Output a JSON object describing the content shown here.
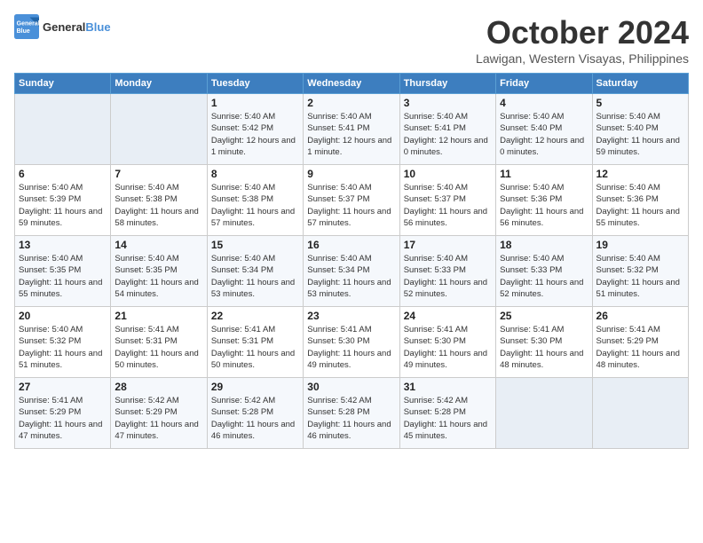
{
  "header": {
    "logo_line1": "General",
    "logo_line2": "Blue",
    "month": "October 2024",
    "location": "Lawigan, Western Visayas, Philippines"
  },
  "days_of_week": [
    "Sunday",
    "Monday",
    "Tuesday",
    "Wednesday",
    "Thursday",
    "Friday",
    "Saturday"
  ],
  "weeks": [
    [
      {
        "num": "",
        "info": "",
        "empty": true
      },
      {
        "num": "",
        "info": "",
        "empty": true
      },
      {
        "num": "1",
        "info": "Sunrise: 5:40 AM\nSunset: 5:42 PM\nDaylight: 12 hours and 1 minute.",
        "empty": false
      },
      {
        "num": "2",
        "info": "Sunrise: 5:40 AM\nSunset: 5:41 PM\nDaylight: 12 hours and 1 minute.",
        "empty": false
      },
      {
        "num": "3",
        "info": "Sunrise: 5:40 AM\nSunset: 5:41 PM\nDaylight: 12 hours and 0 minutes.",
        "empty": false
      },
      {
        "num": "4",
        "info": "Sunrise: 5:40 AM\nSunset: 5:40 PM\nDaylight: 12 hours and 0 minutes.",
        "empty": false
      },
      {
        "num": "5",
        "info": "Sunrise: 5:40 AM\nSunset: 5:40 PM\nDaylight: 11 hours and 59 minutes.",
        "empty": false
      }
    ],
    [
      {
        "num": "6",
        "info": "Sunrise: 5:40 AM\nSunset: 5:39 PM\nDaylight: 11 hours and 59 minutes.",
        "empty": false
      },
      {
        "num": "7",
        "info": "Sunrise: 5:40 AM\nSunset: 5:38 PM\nDaylight: 11 hours and 58 minutes.",
        "empty": false
      },
      {
        "num": "8",
        "info": "Sunrise: 5:40 AM\nSunset: 5:38 PM\nDaylight: 11 hours and 57 minutes.",
        "empty": false
      },
      {
        "num": "9",
        "info": "Sunrise: 5:40 AM\nSunset: 5:37 PM\nDaylight: 11 hours and 57 minutes.",
        "empty": false
      },
      {
        "num": "10",
        "info": "Sunrise: 5:40 AM\nSunset: 5:37 PM\nDaylight: 11 hours and 56 minutes.",
        "empty": false
      },
      {
        "num": "11",
        "info": "Sunrise: 5:40 AM\nSunset: 5:36 PM\nDaylight: 11 hours and 56 minutes.",
        "empty": false
      },
      {
        "num": "12",
        "info": "Sunrise: 5:40 AM\nSunset: 5:36 PM\nDaylight: 11 hours and 55 minutes.",
        "empty": false
      }
    ],
    [
      {
        "num": "13",
        "info": "Sunrise: 5:40 AM\nSunset: 5:35 PM\nDaylight: 11 hours and 55 minutes.",
        "empty": false
      },
      {
        "num": "14",
        "info": "Sunrise: 5:40 AM\nSunset: 5:35 PM\nDaylight: 11 hours and 54 minutes.",
        "empty": false
      },
      {
        "num": "15",
        "info": "Sunrise: 5:40 AM\nSunset: 5:34 PM\nDaylight: 11 hours and 53 minutes.",
        "empty": false
      },
      {
        "num": "16",
        "info": "Sunrise: 5:40 AM\nSunset: 5:34 PM\nDaylight: 11 hours and 53 minutes.",
        "empty": false
      },
      {
        "num": "17",
        "info": "Sunrise: 5:40 AM\nSunset: 5:33 PM\nDaylight: 11 hours and 52 minutes.",
        "empty": false
      },
      {
        "num": "18",
        "info": "Sunrise: 5:40 AM\nSunset: 5:33 PM\nDaylight: 11 hours and 52 minutes.",
        "empty": false
      },
      {
        "num": "19",
        "info": "Sunrise: 5:40 AM\nSunset: 5:32 PM\nDaylight: 11 hours and 51 minutes.",
        "empty": false
      }
    ],
    [
      {
        "num": "20",
        "info": "Sunrise: 5:40 AM\nSunset: 5:32 PM\nDaylight: 11 hours and 51 minutes.",
        "empty": false
      },
      {
        "num": "21",
        "info": "Sunrise: 5:41 AM\nSunset: 5:31 PM\nDaylight: 11 hours and 50 minutes.",
        "empty": false
      },
      {
        "num": "22",
        "info": "Sunrise: 5:41 AM\nSunset: 5:31 PM\nDaylight: 11 hours and 50 minutes.",
        "empty": false
      },
      {
        "num": "23",
        "info": "Sunrise: 5:41 AM\nSunset: 5:30 PM\nDaylight: 11 hours and 49 minutes.",
        "empty": false
      },
      {
        "num": "24",
        "info": "Sunrise: 5:41 AM\nSunset: 5:30 PM\nDaylight: 11 hours and 49 minutes.",
        "empty": false
      },
      {
        "num": "25",
        "info": "Sunrise: 5:41 AM\nSunset: 5:30 PM\nDaylight: 11 hours and 48 minutes.",
        "empty": false
      },
      {
        "num": "26",
        "info": "Sunrise: 5:41 AM\nSunset: 5:29 PM\nDaylight: 11 hours and 48 minutes.",
        "empty": false
      }
    ],
    [
      {
        "num": "27",
        "info": "Sunrise: 5:41 AM\nSunset: 5:29 PM\nDaylight: 11 hours and 47 minutes.",
        "empty": false
      },
      {
        "num": "28",
        "info": "Sunrise: 5:42 AM\nSunset: 5:29 PM\nDaylight: 11 hours and 47 minutes.",
        "empty": false
      },
      {
        "num": "29",
        "info": "Sunrise: 5:42 AM\nSunset: 5:28 PM\nDaylight: 11 hours and 46 minutes.",
        "empty": false
      },
      {
        "num": "30",
        "info": "Sunrise: 5:42 AM\nSunset: 5:28 PM\nDaylight: 11 hours and 46 minutes.",
        "empty": false
      },
      {
        "num": "31",
        "info": "Sunrise: 5:42 AM\nSunset: 5:28 PM\nDaylight: 11 hours and 45 minutes.",
        "empty": false
      },
      {
        "num": "",
        "info": "",
        "empty": true
      },
      {
        "num": "",
        "info": "",
        "empty": true
      }
    ]
  ]
}
